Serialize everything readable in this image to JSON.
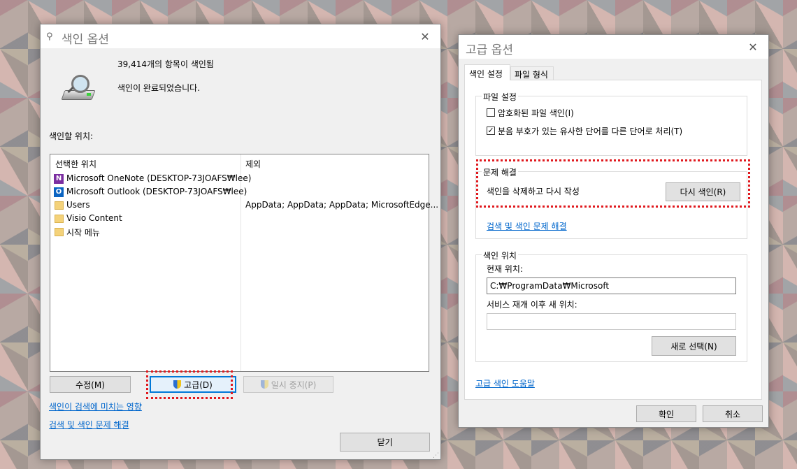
{
  "index_dialog": {
    "title": "색인 옵션",
    "count_text": "39,414개의 항목이 색인됨",
    "status_text": "색인이 완료되었습니다.",
    "locations_label": "색인할 위치:",
    "col_selected": "선택한 위치",
    "col_exclude": "제외",
    "rows": [
      {
        "name": "Microsoft OneNote (DESKTOP-73JOAFS₩lee)",
        "exclude": "",
        "icon": "onenote-icon"
      },
      {
        "name": "Microsoft Outlook (DESKTOP-73JOAFS₩lee)",
        "exclude": "",
        "icon": "outlook-icon"
      },
      {
        "name": "Users",
        "exclude": "AppData; AppData; AppData; MicrosoftEdge...",
        "icon": "folder-icon"
      },
      {
        "name": "Visio Content",
        "exclude": "",
        "icon": "folder-icon"
      },
      {
        "name": "시작 메뉴",
        "exclude": "",
        "icon": "folder-icon"
      }
    ],
    "modify_button": "수정(M)",
    "advanced_button": "고급(D)",
    "pause_button": "일시 중지(P)",
    "link_affect": "색인이 검색에 미치는 영향",
    "link_troubleshoot": "검색 및 색인 문제 해결",
    "close_button": "닫기"
  },
  "advanced_dialog": {
    "title": "고급 옵션",
    "tab_index_settings": "색인 설정",
    "tab_file_types": "파일 형식",
    "file_settings_legend": "파일 설정",
    "encrypt_label": "암호화된 파일 색인(I)",
    "encrypt_checked": false,
    "diacritics_label": "분음 부호가 있는 유사한 단어를 다른 단어로 처리(T)",
    "diacritics_checked": true,
    "troubleshoot_legend": "문제 해결",
    "rebuild_text": "색인을 삭제하고 다시 작성",
    "rebuild_button": "다시 색인(R)",
    "troubleshoot_link": "검색 및 색인 문제 해결",
    "location_legend": "색인 위치",
    "current_label": "현재 위치:",
    "current_value": "C:₩ProgramData₩Microsoft",
    "new_label": "서비스 재개 이후 새 위치:",
    "new_value": "",
    "select_new_button": "새로 선택(N)",
    "help_link": "고급 색인 도움말",
    "ok_button": "확인",
    "cancel_button": "취소"
  },
  "colors": {
    "highlight": "#e0191e",
    "link": "#0066cc"
  }
}
